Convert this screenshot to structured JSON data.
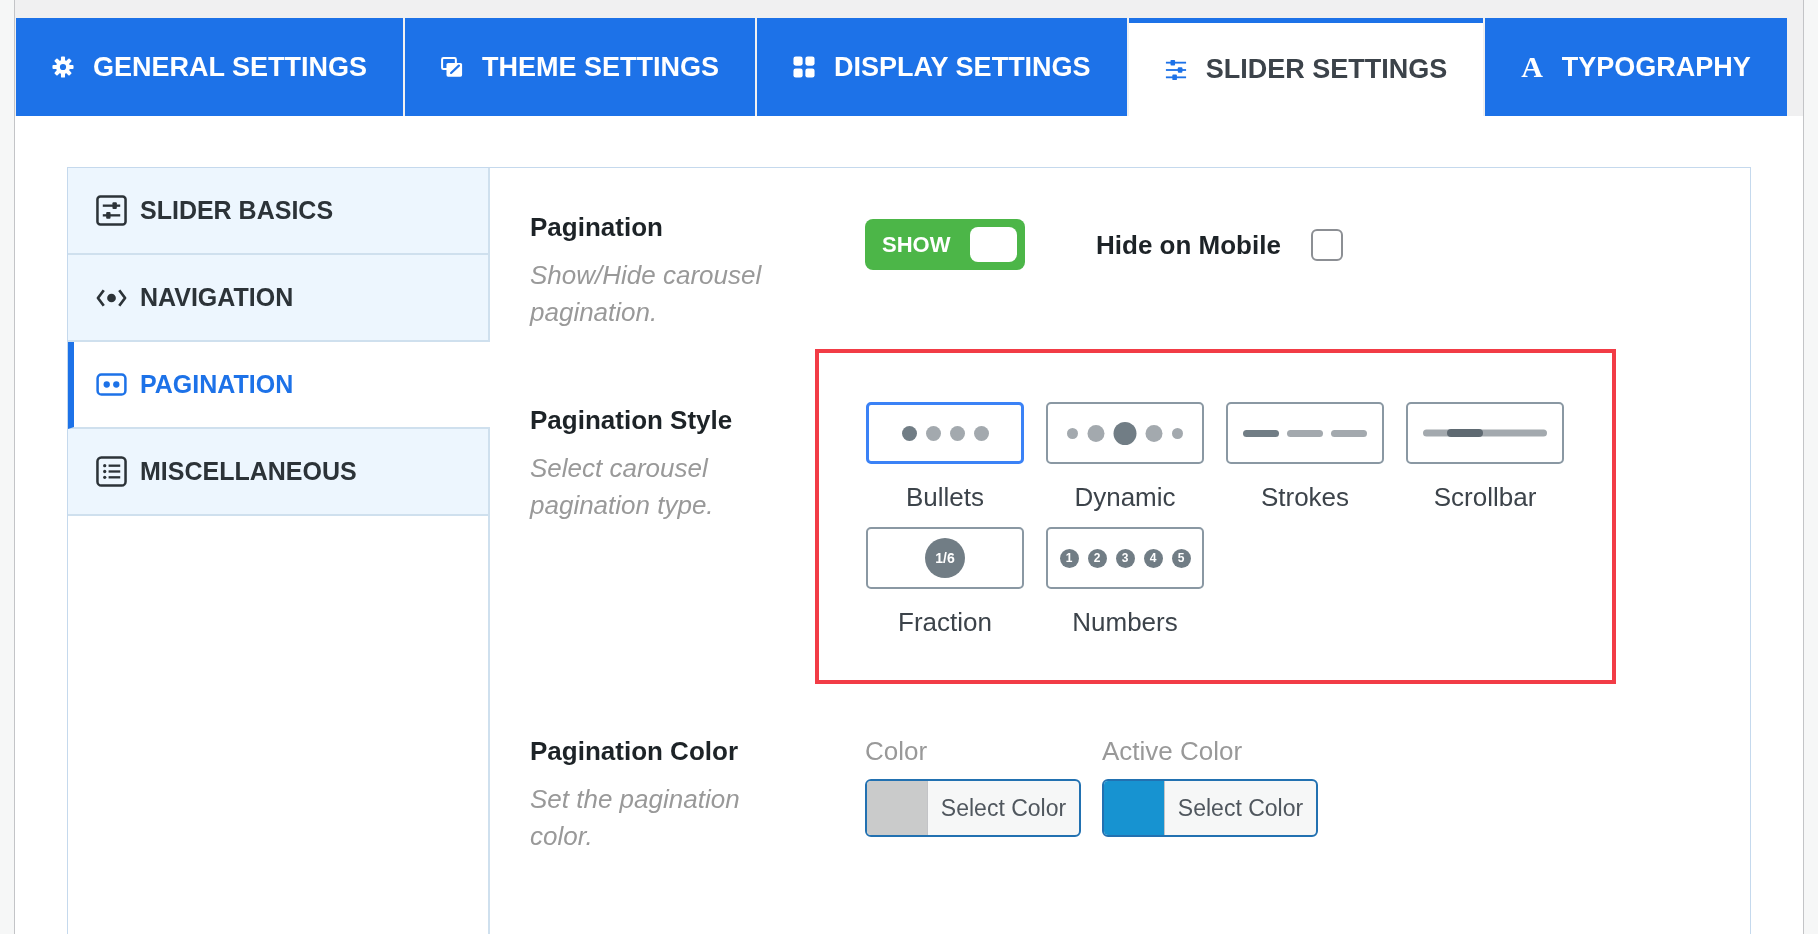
{
  "tabs": [
    {
      "label": "GENERAL SETTINGS",
      "selected": false
    },
    {
      "label": "THEME SETTINGS",
      "selected": false
    },
    {
      "label": "DISPLAY SETTINGS",
      "selected": false
    },
    {
      "label": "SLIDER SETTINGS",
      "selected": true
    },
    {
      "label": "TYPOGRAPHY",
      "icon_glyph": "A",
      "selected": false
    }
  ],
  "sidebar": {
    "items": [
      {
        "label": "SLIDER BASICS",
        "selected": false
      },
      {
        "label": "NAVIGATION",
        "selected": false
      },
      {
        "label": "PAGINATION",
        "selected": true
      },
      {
        "label": "MISCELLANEOUS",
        "selected": false
      }
    ]
  },
  "pagination": {
    "label": "Pagination",
    "description": "Show/Hide carousel pagination.",
    "toggle": {
      "label": "SHOW",
      "on": true
    },
    "hide_on_mobile": {
      "label": "Hide on Mobile",
      "checked": false
    }
  },
  "pagination_style": {
    "label": "Pagination Style",
    "description": "Select carousel pagination type.",
    "options": [
      {
        "kind": "bullets",
        "label": "Bullets",
        "selected": true
      },
      {
        "kind": "dynamic",
        "label": "Dynamic",
        "selected": false
      },
      {
        "kind": "strokes",
        "label": "Strokes",
        "selected": false
      },
      {
        "kind": "scrollbar",
        "label": "Scrollbar",
        "selected": false
      },
      {
        "kind": "fraction",
        "label": "Fraction",
        "preview_text": "1/6",
        "selected": false
      },
      {
        "kind": "numbers",
        "label": "Numbers",
        "preview_numbers": [
          "1",
          "2",
          "3",
          "4",
          "5"
        ],
        "selected": false
      }
    ]
  },
  "pagination_color": {
    "label": "Pagination Color",
    "description": "Set the pagination color.",
    "pickers": [
      {
        "label": "Color",
        "color": "#cacbcb",
        "button": "Select Color"
      },
      {
        "label": "Active Color",
        "color": "#1793d1",
        "button": "Select Color"
      }
    ]
  }
}
